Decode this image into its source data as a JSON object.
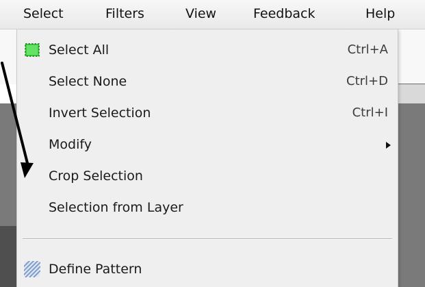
{
  "menubar": {
    "items": [
      {
        "label": "Select"
      },
      {
        "label": "Filters"
      },
      {
        "label": "View"
      },
      {
        "label": "Feedback"
      },
      {
        "label": "Help"
      }
    ]
  },
  "dropdown": {
    "items": [
      {
        "label": "Select All",
        "shortcut": "Ctrl+A",
        "icon": "select-all-icon"
      },
      {
        "label": "Select None",
        "shortcut": "Ctrl+D"
      },
      {
        "label": "Invert Selection",
        "shortcut": "Ctrl+I"
      },
      {
        "label": "Modify",
        "submenu": true
      },
      {
        "label": "Crop Selection"
      },
      {
        "label": "Selection from Layer"
      },
      {
        "label": "Define Pattern",
        "icon": "pattern-icon"
      }
    ]
  },
  "colors": {
    "menu_bg": "#efefef",
    "menubar_bg": "#eeeeee",
    "select_all_icon_green": "#3bd13b",
    "pattern_icon_blue": "#9bb2d6",
    "annotation_arrow": "#000000"
  }
}
